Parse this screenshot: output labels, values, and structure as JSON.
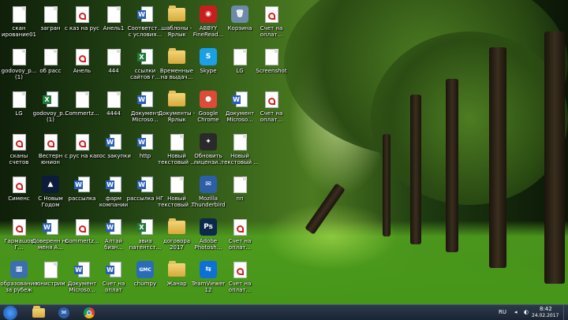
{
  "desktop_icons": [
    {
      "label": "скан ирование012 8_рус»",
      "kind": "doc",
      "icon": "document-icon"
    },
    {
      "label": "загран",
      "kind": "doc",
      "icon": "document-icon"
    },
    {
      "label": "с каз на рус",
      "kind": "pdf",
      "icon": "pdf-icon"
    },
    {
      "label": "Анель1",
      "kind": "doc",
      "icon": "document-icon"
    },
    {
      "label": "Соответст... с условия...",
      "kind": "word",
      "icon": "word-icon"
    },
    {
      "label": "шаблоны - Ярлык",
      "kind": "folder",
      "icon": "folder-shortcut-icon"
    },
    {
      "label": "ABBYY FineRead...",
      "kind": "app",
      "icon": "abbyy-icon",
      "color": "#c81e1e",
      "glyph": "◉"
    },
    {
      "label": "Корзина",
      "kind": "app",
      "icon": "recycle-bin-icon",
      "color": "#6d8aa8",
      "glyph": "🗑"
    },
    {
      "label": "Счет на оплат...",
      "kind": "pdf",
      "icon": "pdf-icon"
    },
    {
      "label": "godovoy_p... (1)",
      "kind": "doc",
      "icon": "document-icon"
    },
    {
      "label": "об расс",
      "kind": "doc",
      "icon": "document-icon"
    },
    {
      "label": "Анель",
      "kind": "pdf",
      "icon": "pdf-icon"
    },
    {
      "label": "444",
      "kind": "doc",
      "icon": "document-icon"
    },
    {
      "label": "ссылки сайтов г...",
      "kind": "excel",
      "icon": "excel-icon"
    },
    {
      "label": "Временные на выдач...",
      "kind": "folder",
      "icon": "folder-shortcut-icon"
    },
    {
      "label": "Skype",
      "kind": "app",
      "icon": "skype-icon",
      "color": "#1aa0e6",
      "glyph": "S"
    },
    {
      "label": "LG",
      "kind": "doc",
      "icon": "document-icon"
    },
    {
      "label": "Screenshot",
      "kind": "doc",
      "icon": "document-icon"
    },
    {
      "label": "LG",
      "kind": "doc",
      "icon": "document-icon"
    },
    {
      "label": "godovoy_p... (1)",
      "kind": "excel",
      "icon": "excel-icon"
    },
    {
      "label": "Commertz...",
      "kind": "doc",
      "icon": "document-icon"
    },
    {
      "label": "4444",
      "kind": "doc",
      "icon": "document-icon"
    },
    {
      "label": "Документ Microso...",
      "kind": "word",
      "icon": "word-icon"
    },
    {
      "label": "Документы - Ярлык",
      "kind": "folder",
      "icon": "folder-shortcut-icon"
    },
    {
      "label": "Google Chrome",
      "kind": "app",
      "icon": "chrome-icon",
      "color": "#dd4b39",
      "glyph": "●"
    },
    {
      "label": "Документ Microso...",
      "kind": "word",
      "icon": "word-icon"
    },
    {
      "label": "Счет на оплат...",
      "kind": "pdf",
      "icon": "pdf-icon"
    },
    {
      "label": "сканы счетов",
      "kind": "pdf",
      "icon": "pdf-icon"
    },
    {
      "label": "Вестерн юнион",
      "kind": "pdf",
      "icon": "pdf-icon"
    },
    {
      "label": "с рус на каз",
      "kind": "pdf",
      "icon": "pdf-icon"
    },
    {
      "label": "гос закупки",
      "kind": "word",
      "icon": "word-icon"
    },
    {
      "label": "http",
      "kind": "word",
      "icon": "word-icon"
    },
    {
      "label": "Новый текстовый ...",
      "kind": "doc",
      "icon": "document-icon"
    },
    {
      "label": "Обновить лицензи...",
      "kind": "app",
      "icon": "update-license-icon",
      "color": "#2a2a2a",
      "glyph": "✦"
    },
    {
      "label": "Новый текстовый ...",
      "kind": "doc",
      "icon": "document-icon"
    },
    {
      "label": "Сименс",
      "kind": "pdf",
      "icon": "pdf-icon"
    },
    {
      "label": "С Новым Годом",
      "kind": "app",
      "icon": "new-year-image-icon",
      "color": "#0d1c3a",
      "glyph": "▲"
    },
    {
      "label": "рассылка",
      "kind": "word",
      "icon": "word-icon"
    },
    {
      "label": "фарм компании",
      "kind": "word",
      "icon": "word-icon"
    },
    {
      "label": "рассылка НГ",
      "kind": "word",
      "icon": "word-icon"
    },
    {
      "label": "Новый текстовый ...",
      "kind": "doc",
      "icon": "document-icon"
    },
    {
      "label": "Mozilla Thunderbird",
      "kind": "app",
      "icon": "thunderbird-icon",
      "color": "#2c5fa8",
      "glyph": "✉"
    },
    {
      "label": "пп",
      "kind": "doc",
      "icon": "document-icon"
    },
    {
      "label": "Гармашов Г...",
      "kind": "pdf",
      "icon": "pdf-icon"
    },
    {
      "label": "Доверенн на меня А...",
      "kind": "word",
      "icon": "word-icon"
    },
    {
      "label": "Commertz...",
      "kind": "pdf",
      "icon": "pdf-icon"
    },
    {
      "label": "Алтай бизн...",
      "kind": "word",
      "icon": "word-icon"
    },
    {
      "label": "авиа патентст...",
      "kind": "excel",
      "icon": "excel-icon"
    },
    {
      "label": "договора 2017",
      "kind": "folder",
      "icon": "folder-icon"
    },
    {
      "label": "Adobe Photosh...",
      "kind": "app",
      "icon": "photoshop-icon",
      "color": "#0b2a4a",
      "glyph": "Ps"
    },
    {
      "label": "Счет на оплат...",
      "kind": "pdf",
      "icon": "pdf-icon"
    },
    {
      "label": "образование за рубеж",
      "kind": "app",
      "icon": "image-icon",
      "color": "#3c6fb0",
      "glyph": "▦"
    },
    {
      "label": "юнистрим",
      "kind": "doc",
      "icon": "document-icon"
    },
    {
      "label": "Документ Microso...",
      "kind": "word",
      "icon": "publisher-icon"
    },
    {
      "label": "Счет на оплат (прилож...",
      "kind": "word",
      "icon": "word-icon"
    },
    {
      "label": "chumpy",
      "kind": "app",
      "icon": "gmc-icon",
      "color": "#2b6cb8",
      "glyph": "GMC"
    },
    {
      "label": "Жанар",
      "kind": "folder",
      "icon": "folder-shortcut-icon"
    },
    {
      "label": "TeamViewer 12",
      "kind": "app",
      "icon": "teamviewer-icon",
      "color": "#0e6fd6",
      "glyph": "⇆"
    },
    {
      "label": "Счет на оплат...",
      "kind": "pdf",
      "icon": "pdf-icon"
    }
  ],
  "taskbar": {
    "pinned": [
      {
        "name": "explorer-icon"
      },
      {
        "name": "thunderbird-icon"
      },
      {
        "name": "chrome-icon"
      }
    ],
    "language": "RU",
    "time": "8:42",
    "date": "24.02.2017"
  }
}
